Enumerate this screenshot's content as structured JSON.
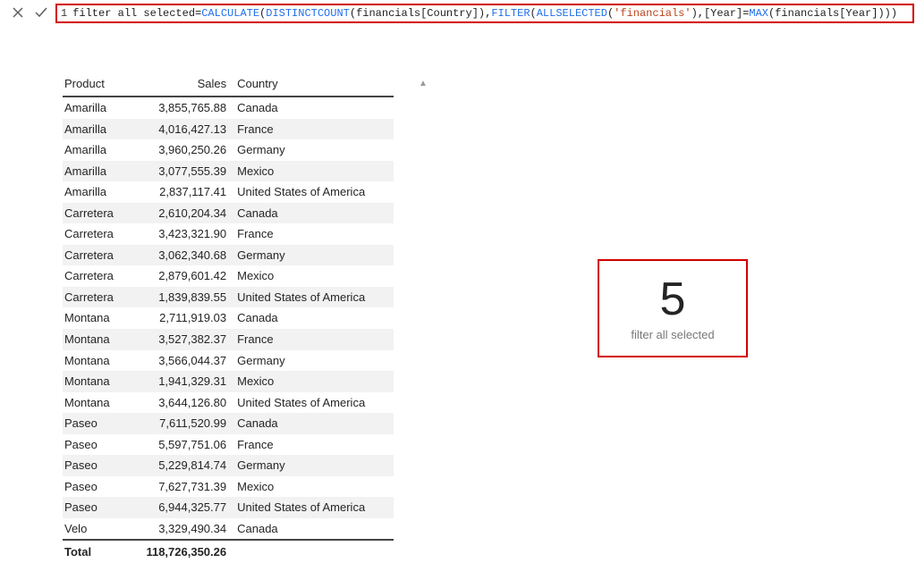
{
  "formula": {
    "line_no": "1",
    "measure_name": "filter all selected",
    "eq": " = ",
    "fn_calculate": "CALCULATE",
    "lp1": "(",
    "fn_distinctcount": "DISTINCTCOUNT",
    "lp2": "(",
    "col_country": "financials[Country]",
    "rp2": ")",
    "comma1": ",",
    "fn_filter": "FILTER",
    "lp3": "(",
    "fn_allselected": "ALLSELECTED",
    "lp4": "(",
    "tbl_lit": "'financials'",
    "rp4": ")",
    "comma2": ",",
    "col_year1": "[Year]",
    "eq2": "=",
    "fn_max": "MAX",
    "lp5": "(",
    "col_year2": "financials[Year]",
    "rp5": ")",
    "rp3": ")",
    "rp1": ")"
  },
  "table": {
    "headers": {
      "product": "Product",
      "sales": "Sales",
      "country": "Country"
    },
    "rows": [
      {
        "product": "Amarilla",
        "sales": "3,855,765.88",
        "country": "Canada"
      },
      {
        "product": "Amarilla",
        "sales": "4,016,427.13",
        "country": "France"
      },
      {
        "product": "Amarilla",
        "sales": "3,960,250.26",
        "country": "Germany"
      },
      {
        "product": "Amarilla",
        "sales": "3,077,555.39",
        "country": "Mexico"
      },
      {
        "product": "Amarilla",
        "sales": "2,837,117.41",
        "country": "United States of America"
      },
      {
        "product": "Carretera",
        "sales": "2,610,204.34",
        "country": "Canada"
      },
      {
        "product": "Carretera",
        "sales": "3,423,321.90",
        "country": "France"
      },
      {
        "product": "Carretera",
        "sales": "3,062,340.68",
        "country": "Germany"
      },
      {
        "product": "Carretera",
        "sales": "2,879,601.42",
        "country": "Mexico"
      },
      {
        "product": "Carretera",
        "sales": "1,839,839.55",
        "country": "United States of America"
      },
      {
        "product": "Montana",
        "sales": "2,711,919.03",
        "country": "Canada"
      },
      {
        "product": "Montana",
        "sales": "3,527,382.37",
        "country": "France"
      },
      {
        "product": "Montana",
        "sales": "3,566,044.37",
        "country": "Germany"
      },
      {
        "product": "Montana",
        "sales": "1,941,329.31",
        "country": "Mexico"
      },
      {
        "product": "Montana",
        "sales": "3,644,126.80",
        "country": "United States of America"
      },
      {
        "product": "Paseo",
        "sales": "7,611,520.99",
        "country": "Canada"
      },
      {
        "product": "Paseo",
        "sales": "5,597,751.06",
        "country": "France"
      },
      {
        "product": "Paseo",
        "sales": "5,229,814.74",
        "country": "Germany"
      },
      {
        "product": "Paseo",
        "sales": "7,627,731.39",
        "country": "Mexico"
      },
      {
        "product": "Paseo",
        "sales": "6,944,325.77",
        "country": "United States of America"
      },
      {
        "product": "Velo",
        "sales": "3,329,490.34",
        "country": "Canada"
      }
    ],
    "total_label": "Total",
    "total_value": "118,726,350.26"
  },
  "card": {
    "value": "5",
    "label": "filter all selected"
  }
}
